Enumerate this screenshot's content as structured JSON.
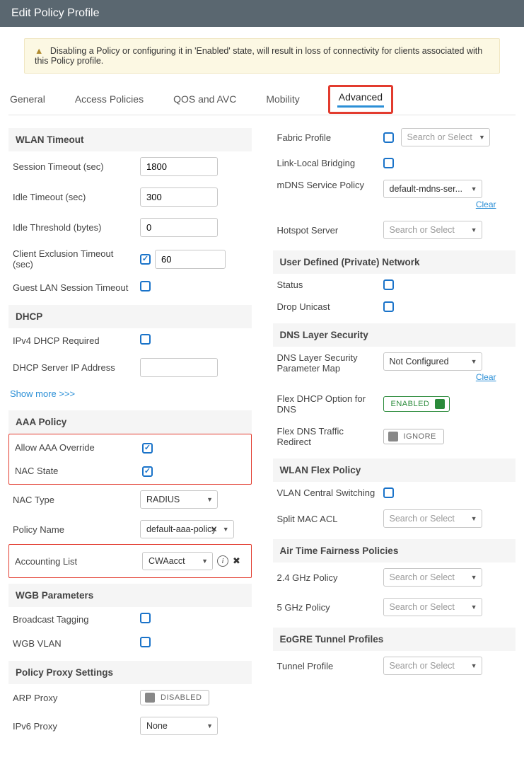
{
  "title": "Edit Policy Profile",
  "alert": {
    "text": "Disabling a Policy or configuring it in 'Enabled' state, will result in loss of connectivity for clients associated with this Policy profile."
  },
  "tabs": {
    "general": "General",
    "access": "Access Policies",
    "qos": "QOS and AVC",
    "mobility": "Mobility",
    "advanced": "Advanced"
  },
  "sections": {
    "wlan_timeout": "WLAN Timeout",
    "dhcp": "DHCP",
    "aaa": "AAA Policy",
    "wgb": "WGB Parameters",
    "proxy": "Policy Proxy Settings",
    "udn": "User Defined (Private) Network",
    "dns": "DNS Layer Security",
    "flex": "WLAN Flex Policy",
    "atf": "Air Time Fairness Policies",
    "eogre": "EoGRE Tunnel Profiles"
  },
  "left": {
    "session_timeout_lbl": "Session Timeout (sec)",
    "session_timeout_val": "1800",
    "idle_timeout_lbl": "Idle Timeout (sec)",
    "idle_timeout_val": "300",
    "idle_threshold_lbl": "Idle Threshold (bytes)",
    "idle_threshold_val": "0",
    "client_excl_lbl": "Client Exclusion Timeout (sec)",
    "client_excl_val": "60",
    "guest_lan_lbl": "Guest LAN Session Timeout",
    "ipv4_req_lbl": "IPv4 DHCP Required",
    "dhcp_server_lbl": "DHCP Server IP Address",
    "dhcp_server_val": "",
    "showmore": "Show more >>>",
    "allow_aaa_lbl": "Allow AAA Override",
    "nac_state_lbl": "NAC State",
    "nac_type_lbl": "NAC Type",
    "nac_type_val": "RADIUS",
    "policy_name_lbl": "Policy Name",
    "policy_name_val": "default-aaa-policy",
    "acct_list_lbl": "Accounting List",
    "acct_list_val": "CWAacct",
    "broadcast_lbl": "Broadcast Tagging",
    "wgb_vlan_lbl": "WGB VLAN",
    "arp_proxy_lbl": "ARP Proxy",
    "arp_proxy_val": "DISABLED",
    "ipv6_proxy_lbl": "IPv6 Proxy",
    "ipv6_proxy_val": "None"
  },
  "right": {
    "fabric_lbl": "Fabric Profile",
    "fabric_ph": "Search or Select",
    "linklocal_lbl": "Link-Local Bridging",
    "mdns_lbl": "mDNS Service Policy",
    "mdns_val": "default-mdns-ser...",
    "clear": "Clear",
    "hotspot_lbl": "Hotspot Server",
    "hotspot_ph": "Search or Select",
    "status_lbl": "Status",
    "drop_lbl": "Drop Unicast",
    "dns_param_lbl": "DNS Layer Security Parameter Map",
    "dns_param_val": "Not Configured",
    "flex_dhcp_lbl": "Flex DHCP Option for DNS",
    "flex_dhcp_val": "ENABLED",
    "flex_redirect_lbl": "Flex DNS Traffic Redirect",
    "flex_redirect_val": "IGNORE",
    "vlan_central_lbl": "VLAN Central Switching",
    "split_mac_lbl": "Split MAC ACL",
    "split_mac_ph": "Search or Select",
    "p24_lbl": "2.4 GHz Policy",
    "p24_ph": "Search or Select",
    "p5_lbl": "5 GHz Policy",
    "p5_ph": "Search or Select",
    "tunnel_lbl": "Tunnel Profile",
    "tunnel_ph": "Search or Select"
  }
}
